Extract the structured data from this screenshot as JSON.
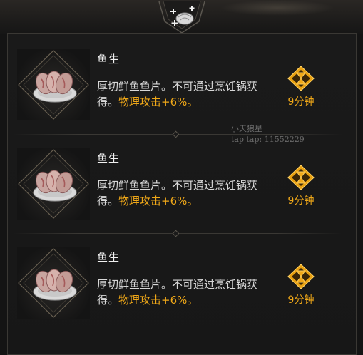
{
  "header": {
    "icon": "food-buff-icon"
  },
  "items": [
    {
      "name": "鱼生",
      "desc_main": "厚切鲜鱼鱼片。不可通过烹饪锅获得。",
      "desc_buff": "物理攻击+6%。",
      "duration": "9分钟",
      "icon": "sashimi-plate-icon"
    },
    {
      "name": "鱼生",
      "desc_main": "厚切鲜鱼鱼片。不可通过烹饪锅获得。",
      "desc_buff": "物理攻击+6%。",
      "duration": "9分钟",
      "icon": "sashimi-plate-icon"
    },
    {
      "name": "鱼生",
      "desc_main": "厚切鲜鱼鱼片。不可通过烹饪锅获得。",
      "desc_buff": "物理攻击+6%。",
      "duration": "9分钟",
      "icon": "sashimi-plate-icon"
    }
  ],
  "watermark": {
    "line1": "小天狼星",
    "line2": "tap tap: 11552229"
  },
  "colors": {
    "accent": "#f0a818",
    "text": "#d8d8d8",
    "background": "#171717"
  }
}
